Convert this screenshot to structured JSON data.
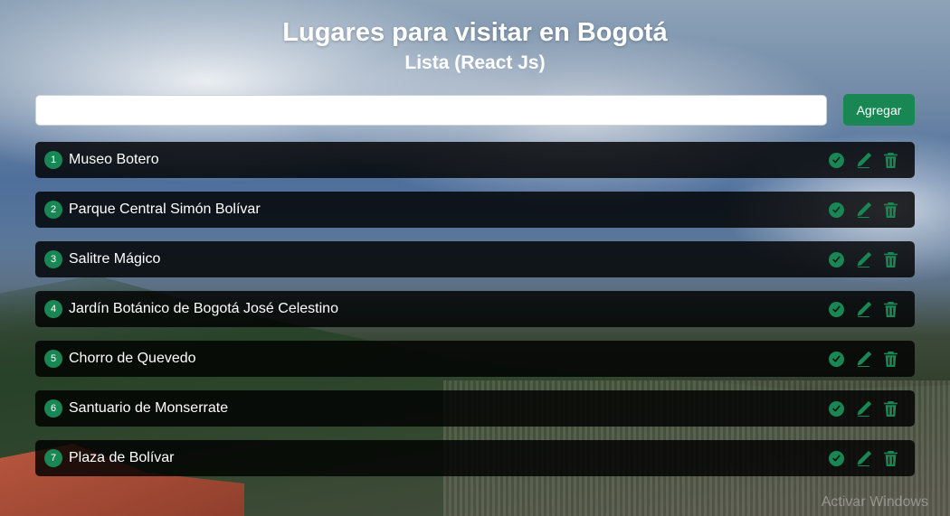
{
  "header": {
    "title": "Lugares para visitar en Bogotá",
    "subtitle": "Lista (React Js)"
  },
  "form": {
    "input_value": "",
    "add_button_label": "Agregar"
  },
  "places": [
    {
      "number": "1",
      "name": "Museo Botero"
    },
    {
      "number": "2",
      "name": "Parque Central Simón Bolívar"
    },
    {
      "number": "3",
      "name": "Salitre Mágico"
    },
    {
      "number": "4",
      "name": "Jardín Botánico de Bogotá José Celestino"
    },
    {
      "number": "5",
      "name": "Chorro de Quevedo"
    },
    {
      "number": "6",
      "name": "Santuario de Monserrate"
    },
    {
      "number": "7",
      "name": "Plaza de Bolívar"
    }
  ],
  "actions": {
    "icons": [
      "check-circle-icon",
      "pencil-icon",
      "trash-icon"
    ],
    "icon_color": "#198754"
  },
  "colors": {
    "accent": "#198754",
    "list_item_bg": "rgba(0,0,0,0.82)"
  },
  "watermark": "Activar Windows"
}
